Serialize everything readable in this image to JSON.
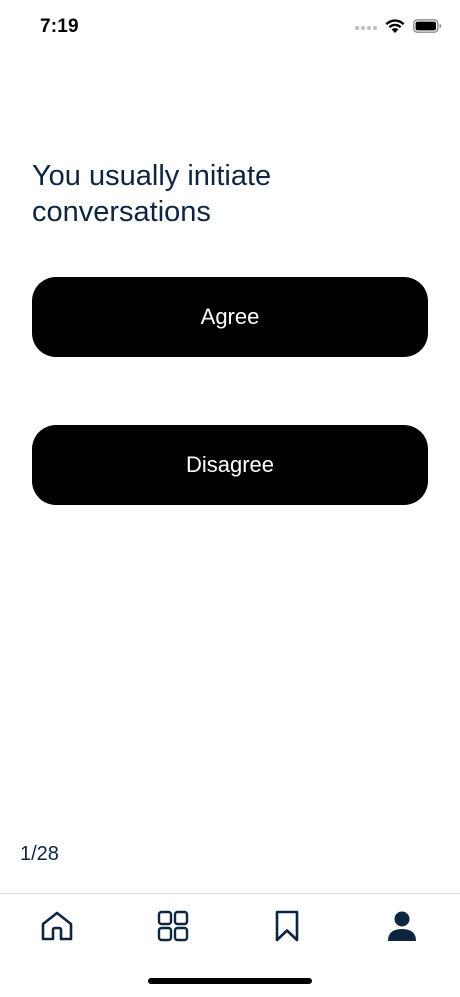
{
  "status_bar": {
    "time": "7:19",
    "icons": [
      "signal-dots-icon",
      "wifi-icon",
      "battery-icon"
    ]
  },
  "question": {
    "text": "You usually initiate conversations"
  },
  "answers": {
    "agree_label": "Agree",
    "disagree_label": "Disagree"
  },
  "progress": {
    "label": "1/28",
    "current": 1,
    "total": 28
  },
  "tab_bar": {
    "tabs": [
      {
        "icon": "home-icon",
        "active": false
      },
      {
        "icon": "grid-icon",
        "active": false
      },
      {
        "icon": "bookmark-icon",
        "active": false
      },
      {
        "icon": "profile-icon",
        "active": true
      }
    ]
  },
  "colors": {
    "text_primary": "#0d2540",
    "button_bg": "#000000",
    "button_text": "#ffffff",
    "background": "#ffffff"
  }
}
